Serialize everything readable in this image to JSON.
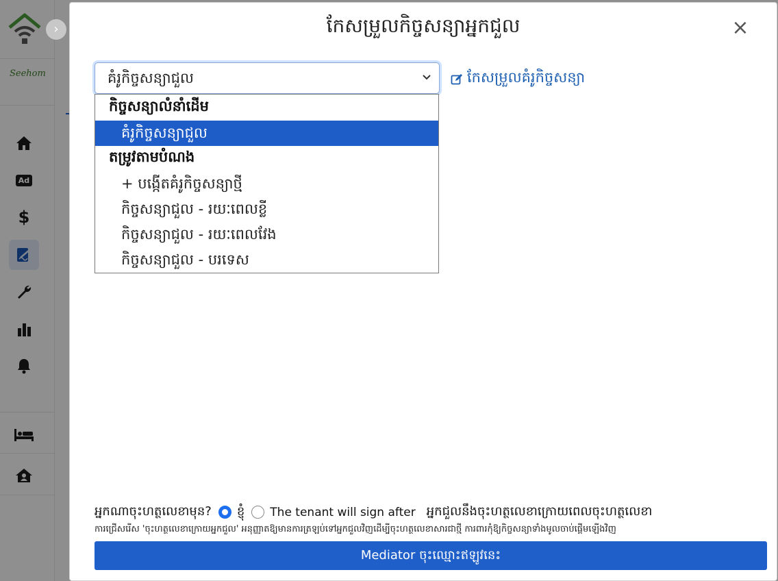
{
  "modal": {
    "title": "កែសម្រួលកិច្ចសន្យាអ្នកជួល",
    "close_glyph": "×"
  },
  "template_select": {
    "selected_value": "គំរូកិច្ចសន្យាជួល",
    "chevron": "⌄"
  },
  "edit_template_link": {
    "label": "កែសម្រួលគំរូកិច្ចសន្យា",
    "icon": "edit-icon"
  },
  "dropdown": {
    "groups": [
      {
        "label": "កិច្ចសន្យាលំនាំដើម",
        "options": [
          {
            "label": "គំរូកិច្ចសន្យាជួល",
            "selected": true
          }
        ]
      },
      {
        "label": "តម្រូវតាមបំណង",
        "options": [
          {
            "label": "+ បង្កើតគំរូកិច្ចសន្យាថ្មី",
            "selected": false
          },
          {
            "label": "កិច្ចសន្យាជួល - រយៈពេលខ្លី",
            "selected": false
          },
          {
            "label": "កិច្ចសន្យាជួល - រយៈពេលវែង",
            "selected": false
          },
          {
            "label": "កិច្ចសន្យាជួល - បរទេស",
            "selected": false
          }
        ]
      }
    ]
  },
  "sign_order": {
    "question": "អ្នកណាចុះហត្ថលេខាមុន?",
    "option_me": "ខ្ញុំ",
    "option_tenant_after": "The tenant will sign after",
    "tenant_after_desc": "អ្នកជួលនឹងចុះហត្ថលេខាក្រោយពេលចុះហត្ថលេខា",
    "note": "ការជ្រើសរើស 'ចុះហត្ថលេខាក្រោយអ្នកជួល' អនុញ្ញាតឱ្យមានការត្រឡប់ទៅអ្នកជួលវិញដើម្បីចុះហត្ថលេខាសារជាថ្មី ការពារកុំឱ្យកិច្ចសន្យាទាំងមូលចាប់ផ្តើមឡើងវិញ"
  },
  "submit_button": {
    "label": "Mediator ចុះឈ្មោះឥឡូវនេះ"
  },
  "sidebar": {
    "brand": "Seehom",
    "items": [
      {
        "icon": "home-icon"
      },
      {
        "icon": "ad-icon",
        "label": "Ad"
      },
      {
        "icon": "dollar-icon",
        "label": "$"
      },
      {
        "icon": "contract-edit-icon"
      },
      {
        "icon": "wrench-icon"
      },
      {
        "icon": "bar-chart-icon"
      },
      {
        "icon": "bell-icon"
      },
      {
        "icon": "bed-icon"
      },
      {
        "icon": "house-user-icon"
      }
    ],
    "colors": {
      "active_bg": "#dbe4f2",
      "active_fg": "#1a55b0"
    }
  },
  "colors": {
    "primary": "#1f5fc9",
    "option_selected_bg": "#1e5dc8",
    "link": "#1d5fb0",
    "overlay": "rgba(0,0,0,0.42)"
  }
}
